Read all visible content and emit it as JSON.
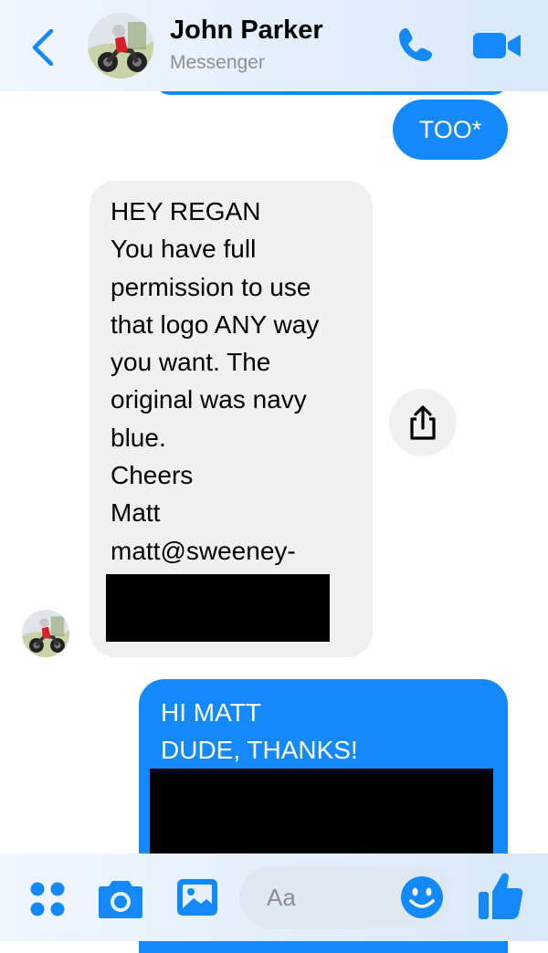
{
  "colors": {
    "accent": "#1389fc",
    "incoming_bubble": "#f0f0f0",
    "header_bg": "#e4effb",
    "redaction": "#000000"
  },
  "header": {
    "contact_name": "John Parker",
    "subtitle": "Messenger",
    "back_icon": "chevron-left-icon",
    "call_icon": "phone-icon",
    "video_icon": "video-camera-icon"
  },
  "messages": [
    {
      "direction": "outgoing",
      "lines": [
        "TOO*"
      ]
    },
    {
      "direction": "incoming",
      "lines": [
        "HEY REGAN",
        "You have full",
        "permission to use",
        "that logo ANY way",
        "you want.  The",
        "original was navy",
        "blue.",
        "Cheers",
        "Matt",
        "matt@sweeney-"
      ],
      "redacted": true,
      "share_icon": "share-icon"
    },
    {
      "direction": "outgoing",
      "lines": [
        "HI MATT",
        "DUDE, THANKS!"
      ],
      "redacted": true
    }
  ],
  "composer": {
    "placeholder": "Aa",
    "icons": [
      "menu-dots-icon",
      "camera-icon",
      "gallery-icon",
      "emoji-icon",
      "thumbs-up-icon"
    ]
  }
}
